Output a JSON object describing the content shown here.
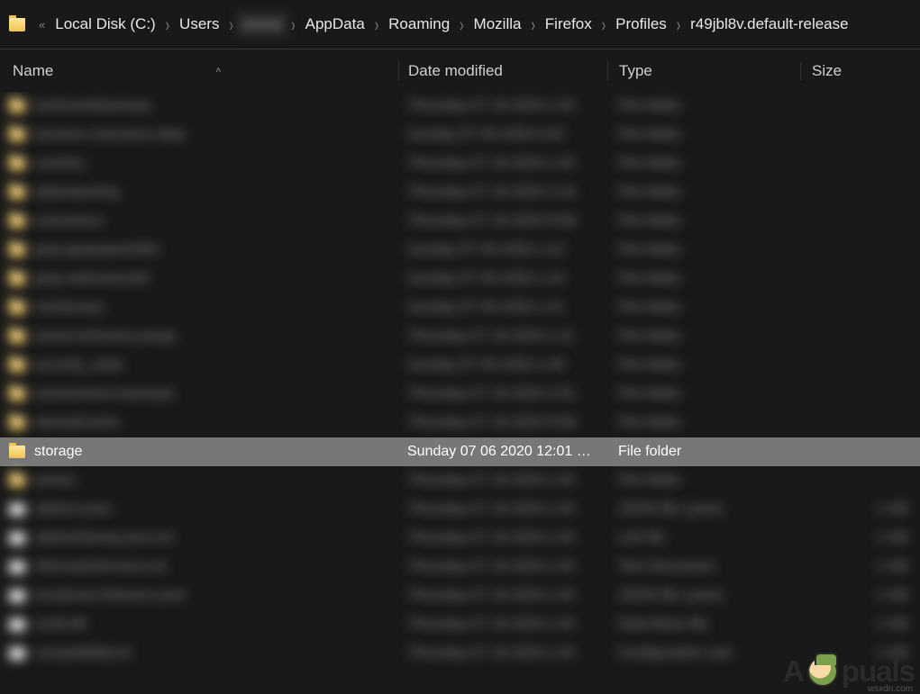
{
  "breadcrumb": {
    "overflow": "«",
    "items": [
      {
        "label": "Local Disk (C:)",
        "blurred": false
      },
      {
        "label": "Users",
        "blurred": false
      },
      {
        "label": "xxxxx",
        "blurred": true
      },
      {
        "label": "AppData",
        "blurred": false
      },
      {
        "label": "Roaming",
        "blurred": false
      },
      {
        "label": "Mozilla",
        "blurred": false
      },
      {
        "label": "Firefox",
        "blurred": false
      },
      {
        "label": "Profiles",
        "blurred": false
      },
      {
        "label": "r49jbl8v.default-release",
        "blurred": false
      }
    ]
  },
  "columns": {
    "name": "Name",
    "date": "Date modified",
    "type": "Type",
    "size": "Size",
    "sort_indicator": "˄"
  },
  "rows": [
    {
      "name": "bookmarkbackups",
      "date": "Thursday 07 16 2020 1:52",
      "type": "File folder",
      "size": "",
      "icon": "folder",
      "blurred": true,
      "selected": false
    },
    {
      "name": "browser-extension-data",
      "date": "Sunday 07 05 2020 9:42",
      "type": "File folder",
      "size": "",
      "icon": "folder",
      "blurred": true,
      "selected": false
    },
    {
      "name": "crashes",
      "date": "Thursday 07 16 2020 1:52",
      "type": "File folder",
      "size": "",
      "icon": "folder",
      "blurred": true,
      "selected": false
    },
    {
      "name": "datareporting",
      "date": "Thursday 07 16 2020 2:14",
      "type": "File folder",
      "size": "",
      "icon": "folder",
      "blurred": true,
      "selected": false
    },
    {
      "name": "extensions",
      "date": "Thursday 07 16 2020 9:58",
      "type": "File folder",
      "size": "",
      "icon": "folder",
      "blurred": true,
      "selected": false
    },
    {
      "name": "gmp-gmpopenh264",
      "date": "Sunday 07 05 2020 1:22",
      "type": "File folder",
      "size": "",
      "icon": "folder",
      "blurred": true,
      "selected": false
    },
    {
      "name": "gmp-widevinecdm",
      "date": "Sunday 07 05 2020 1:24",
      "type": "File folder",
      "size": "",
      "icon": "folder",
      "blurred": true,
      "selected": false
    },
    {
      "name": "minidumps",
      "date": "Sunday 07 05 2020 1:21",
      "type": "File folder",
      "size": "",
      "icon": "folder",
      "blurred": true,
      "selected": false
    },
    {
      "name": "saved-telemetry-pings",
      "date": "Thursday 07 16 2020 1:11",
      "type": "File folder",
      "size": "",
      "icon": "folder",
      "blurred": true,
      "selected": false
    },
    {
      "name": "security_state",
      "date": "Sunday 07 05 2020 1:40",
      "type": "File folder",
      "size": "",
      "icon": "folder",
      "blurred": true,
      "selected": false
    },
    {
      "name": "sessionstore-backups",
      "date": "Thursday 07 16 2020 2:01",
      "type": "File folder",
      "size": "",
      "icon": "folder",
      "blurred": true,
      "selected": false
    },
    {
      "name": "startupCache",
      "date": "Thursday 07 16 2020 9:58",
      "type": "File folder",
      "size": "",
      "icon": "folder",
      "blurred": true,
      "selected": false
    },
    {
      "name": "storage",
      "date": "Sunday 07 06 2020 12:01 …",
      "type": "File folder",
      "size": "",
      "icon": "folder",
      "blurred": false,
      "selected": true
    },
    {
      "name": "weave",
      "date": "Thursday 07 16 2020 1:52",
      "type": "File folder",
      "size": "",
      "icon": "folder",
      "blurred": true,
      "selected": false
    },
    {
      "name": "addons.json",
      "date": "Thursday 07 16 2020 1:52",
      "type": "JSON file (.json)",
      "size": "1 KB",
      "icon": "doc",
      "blurred": true,
      "selected": false
    },
    {
      "name": "addonStartup.json.lz4",
      "date": "Thursday 07 16 2020 1:52",
      "type": "LZ4 file",
      "size": "1 KB",
      "icon": "doc",
      "blurred": true,
      "selected": false
    },
    {
      "name": "AlternateServices.txt",
      "date": "Thursday 07 16 2020 1:52",
      "type": "Text Document",
      "size": "1 KB",
      "icon": "doc",
      "blurred": true,
      "selected": false
    },
    {
      "name": "broadcast-listeners.json",
      "date": "Thursday 07 16 2020 1:52",
      "type": "JSON file (.json)",
      "size": "1 KB",
      "icon": "doc",
      "blurred": true,
      "selected": false
    },
    {
      "name": "cert9.db",
      "date": "Thursday 07 16 2020 1:52",
      "type": "Data Base file",
      "size": "1 KB",
      "icon": "doc",
      "blurred": true,
      "selected": false
    },
    {
      "name": "compatibility.ini",
      "date": "Thursday 07 16 2020 1:52",
      "type": "Configuration sett",
      "size": "1 KB",
      "icon": "doc",
      "blurred": true,
      "selected": false
    }
  ],
  "watermark": {
    "brand_pre": "A",
    "brand_post": "puals",
    "sub": "wsxdn.com"
  }
}
